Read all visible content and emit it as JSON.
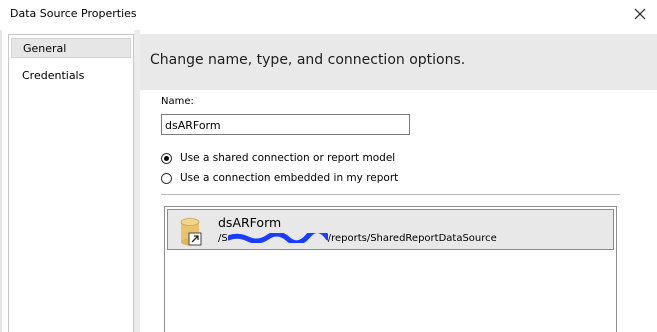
{
  "window": {
    "title": "Data Source Properties"
  },
  "sidebar": {
    "items": [
      {
        "label": "General",
        "selected": true
      },
      {
        "label": "Credentials",
        "selected": false
      }
    ]
  },
  "main": {
    "header": "Change name, type, and connection options.",
    "name_label": "Name:",
    "name_value": "dsARForm",
    "radio_options": [
      {
        "label": "Use a shared connection or report model",
        "checked": true
      },
      {
        "label": "Use a connection embedded in my report",
        "checked": false
      }
    ],
    "shared_sources": [
      {
        "name": "dsARForm",
        "path_prefix": "/S",
        "path_suffix": "/reports/SharedReportDataSource",
        "icon": "shared-datasource-icon"
      }
    ]
  },
  "colors": {
    "header_band": "#e9e9e9",
    "selected_item": "#e8e8e8",
    "redaction_scribble": "#1a3cff",
    "datasource_cylinder": "#e9c36b"
  }
}
